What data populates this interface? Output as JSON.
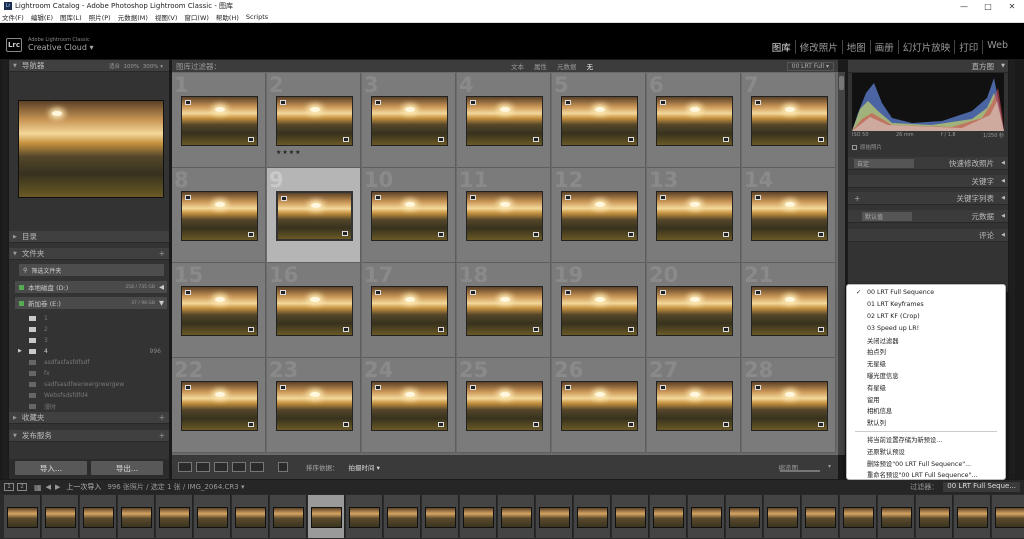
{
  "window": {
    "title": "Lightroom Catalog - Adobe Photoshop Lightroom Classic - 图库",
    "controls": [
      "—",
      "□",
      "✕"
    ]
  },
  "menu": [
    "文件(F)",
    "编辑(E)",
    "图库(L)",
    "照片(P)",
    "元数据(M)",
    "视图(V)",
    "窗口(W)",
    "帮助(H)",
    "Scripts"
  ],
  "identity": {
    "logo": "Lrc",
    "adobe": "Adobe Lightroom Classic",
    "cloud": "Creative Cloud ▾"
  },
  "modules": [
    "图库",
    "修改照片",
    "地图",
    "画册",
    "幻灯片放映",
    "打印",
    "Web"
  ],
  "active_module": "图库",
  "left": {
    "navigator": {
      "title": "导航器",
      "opts": "适合 ‌ 100% ‌ 300% ▾"
    },
    "catalog": "目录",
    "folders": "文件夹",
    "filter_folders": "筛选文件夹",
    "volumes": [
      {
        "name": "本地磁盘 (D:)",
        "info": "258 / 735 GB"
      },
      {
        "name": "新加卷 (E:)",
        "info": "37 / 98 GB"
      }
    ],
    "folder_rows": [
      {
        "name": "1",
        "count": ""
      },
      {
        "name": "2",
        "count": ""
      },
      {
        "name": "3",
        "count": ""
      },
      {
        "name": "4",
        "count": "996"
      },
      {
        "name": "asdfasfasfdfsdf",
        "count": ""
      },
      {
        "name": "fx",
        "count": ""
      },
      {
        "name": "sadfsasdfwerwergrwergew",
        "count": ""
      },
      {
        "name": "Websfsdsfdfd4",
        "count": ""
      },
      {
        "name": "漫时",
        "count": ""
      }
    ],
    "collections": "收藏夹",
    "publish": "发布服务",
    "import_btn": "导入...",
    "export_btn": "导出..."
  },
  "filterbar": {
    "title": "图库过滤器：",
    "opts": [
      "文本",
      "属性",
      "元数据",
      "无"
    ],
    "active": "无",
    "preset": "00 LRT Full ▾"
  },
  "grid_numbers": [
    "1",
    "2",
    "3",
    "4",
    "5",
    "6",
    "7",
    "8",
    "9",
    "10",
    "11",
    "12",
    "13",
    "14",
    "15",
    "16",
    "17",
    "18",
    "19",
    "20",
    "21",
    "22",
    "23",
    "24",
    "25",
    "26",
    "27",
    "28"
  ],
  "selected_cell": "9",
  "rated_cell": "2",
  "stars": "★★★★",
  "toolbar": {
    "sort_label": "排序依据：",
    "sort_value": "拍摄时间 ▾",
    "thumbs_label": "缩览图"
  },
  "right": {
    "histogram": "直方图",
    "histo_info": {
      "iso": "ISO 50",
      "mm": "26 mm",
      "f": "f / 1.8",
      "shutter": "1/250 秒"
    },
    "orig": "原始照片",
    "quick_develop": "快速修改照片",
    "quick_preset": "自定",
    "keywording": "关键字",
    "keyword_list": "关键字列表",
    "metadata": "元数据",
    "metadata_preset": "默认值",
    "comments": "评论"
  },
  "dropdown": {
    "checked": "00 LRT Full Sequence",
    "items": [
      "00 LRT Full Sequence",
      "01 LRT Keyframes",
      "02 LRT KF (Crop)",
      "03 Speed up LR!",
      "关闭过滤器",
      "拍点列",
      "无星级",
      "曝光度信息",
      "有星级",
      "留用",
      "相机信息",
      "默认列"
    ],
    "actions": [
      "将当前设置存储为新预设...",
      "还原默认预设",
      "删除预设\"00 LRT Full Sequence\"...",
      "重命名预设\"00 LRT Full Sequence\"..."
    ]
  },
  "filmstrip": {
    "view1": "1",
    "view2": "2",
    "source": "上一次导入",
    "info": "996 张照片 / 选定 1 张 / IMG_2064.CR3 ▾",
    "filter_label": "过滤器：",
    "filter_value": "00 LRT Full Seque..."
  }
}
